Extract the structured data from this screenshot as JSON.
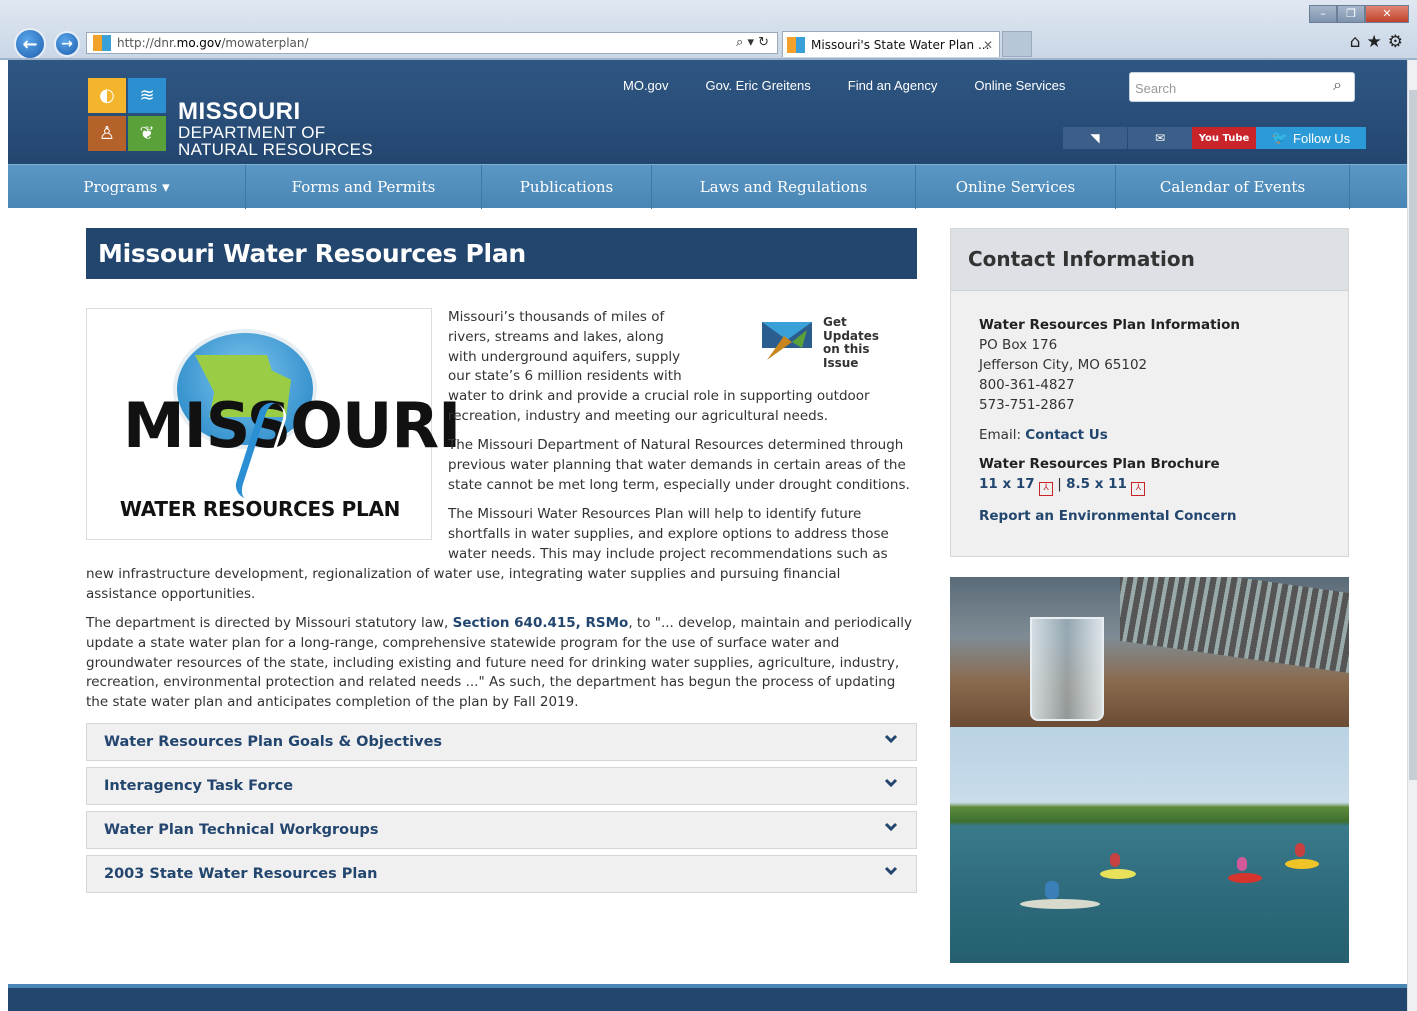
{
  "browser": {
    "url_prefix": "http://dnr.",
    "url_host": "mo.gov",
    "url_path": "/mowaterplan/",
    "address_controls": "⌕ ▾ ↻",
    "tab_title": "Missouri's State Water Plan ...",
    "tab_close": "✕",
    "back_icon": "←",
    "forward_icon": "→",
    "window_controls": [
      "–",
      "❐",
      "✕"
    ],
    "toolbar_icons": "⌂★⚙"
  },
  "header": {
    "logo_line1": "MISSOURI",
    "logo_line2": "DEPARTMENT OF",
    "logo_line3": "NATURAL RESOURCES",
    "util_links": [
      "MO.gov",
      "Gov. Eric Greitens",
      "Find an Agency",
      "Online Services"
    ],
    "search_placeholder": "Search",
    "search_icon": "⌕",
    "rss_icon": "◥",
    "mail_icon": "✉",
    "youtube_label": "You Tube",
    "follow_label": "Follow Us"
  },
  "nav": [
    {
      "label": "Programs ▾",
      "w": 238
    },
    {
      "label": "Forms and Permits",
      "w": 236
    },
    {
      "label": "Publications",
      "w": 170
    },
    {
      "label": "Laws and Regulations",
      "w": 264
    },
    {
      "label": "Online Services",
      "w": 200
    },
    {
      "label": "Calendar of Events",
      "w": 234
    }
  ],
  "main": {
    "title": "Missouri Water Resources Plan",
    "logo_big": "MISSOURI",
    "logo_sub": "WATER RESOURCES PLAN",
    "updates_line1": "Get Updates",
    "updates_line2": "on this",
    "updates_line3": "Issue",
    "p1_top": "Missouri’s thousands of miles of rivers, streams and lakes, along with underground aquifers, supply our state’s 6 million residents with",
    "p1_bottom": "water to drink and provide a crucial role in supporting outdoor recreation, industry and meeting our agricultural needs.",
    "p2": "The Missouri Department of Natural Resources determined through previous water planning that water demands in certain areas of the state cannot be met long term, especially under drought conditions.",
    "p3_top": "The Missouri Water Resources Plan will help to identify future shortfalls in water supplies, and explore options to address those water needs. This may include project recommendations such as",
    "p3_bottom": "new infrastructure development, regionalization of water use, integrating water supplies and pursuing financial assistance opportunities.",
    "p4_before": "The department is directed by Missouri statutory law, ",
    "p4_link": "Section 640.415, RSMo",
    "p4_after": ", to \"... develop, maintain and periodically update a state water plan for a long-range, comprehensive statewide program for the use of surface water and groundwater resources of the state, including existing and future need for drinking water supplies, agriculture, industry, recreation, environmental protection and related needs ...\" As such, the department has begun the process of updating the state water plan and anticipates completion of the plan by Fall 2019.",
    "accordions": [
      "Water Resources Plan Goals & Objectives",
      "Interagency Task Force",
      "Water Plan Technical Workgroups",
      "2003 State Water Resources Plan"
    ]
  },
  "sidebar": {
    "heading": "Contact Information",
    "info_title": "Water Resources Plan Information",
    "address1": "PO Box 176",
    "address2": "Jefferson City, MO 65102",
    "phone1": "800-361-4827",
    "phone2": "573-751-2867",
    "email_label": "Email: ",
    "email_link": "Contact Us",
    "brochure_title": "Water Resources Plan Brochure",
    "brochure_a": "11 x 17",
    "brochure_sep": " | ",
    "brochure_b": "8.5 x 11",
    "pdf_icon": "⅄",
    "report_link": "Report an Environmental Concern"
  }
}
